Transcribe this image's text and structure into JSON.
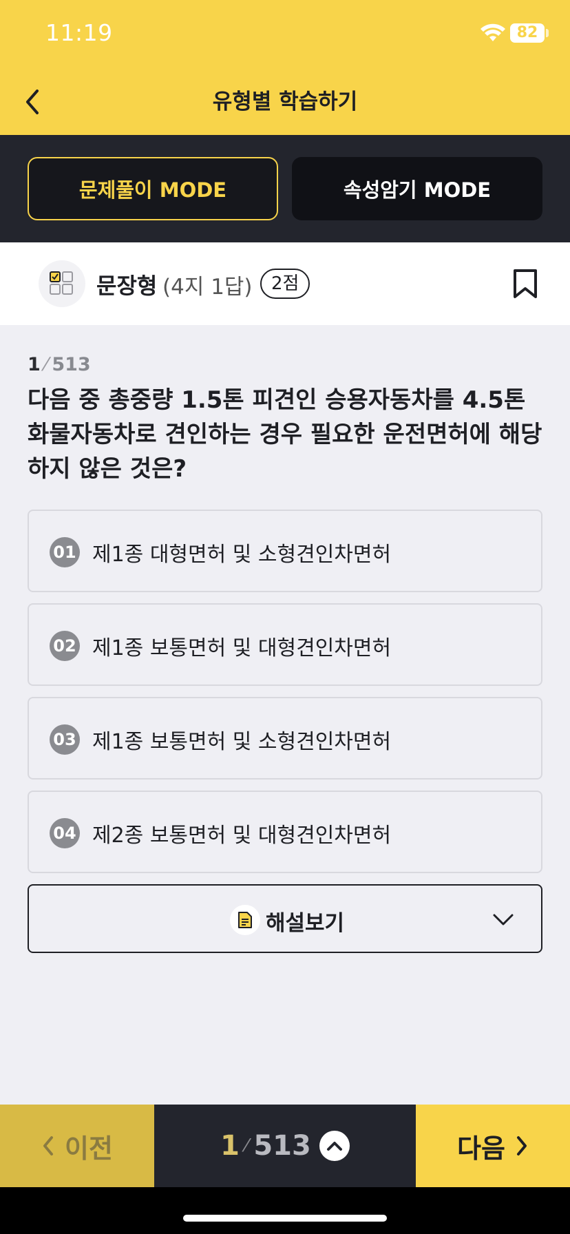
{
  "status_bar": {
    "time": "11:19",
    "battery": "82"
  },
  "nav": {
    "title": "유형별 학습하기"
  },
  "modes": {
    "active_label": "문제풀이 MODE",
    "inactive_label": "속성암기 MODE"
  },
  "question_type": {
    "label": "문장형",
    "desc": "(4지 1답)",
    "score": "2점"
  },
  "counter": {
    "current": "1",
    "separator": "⁄",
    "total": "513"
  },
  "question": {
    "text": "다음 중 총중량 1.5톤 피견인 승용자동차를 4.5톤 화물자동차로 견인하는 경우 필요한 운전면허에 해당하지 않은 것은?"
  },
  "options": [
    {
      "num": "01",
      "text": "제1종 대형면허 및 소형견인차면허"
    },
    {
      "num": "02",
      "text": "제1종 보통면허 및 대형견인차면허"
    },
    {
      "num": "03",
      "text": "제1종 보통면허 및 소형견인차면허"
    },
    {
      "num": "04",
      "text": "제2종 보통면허 및 대형견인차면허"
    }
  ],
  "explain": {
    "label": "해설보기"
  },
  "bottom": {
    "prev_label": "이전",
    "next_label": "다음",
    "pager_current": "1",
    "pager_separator": "⁄",
    "pager_total": "513"
  },
  "colors": {
    "accent": "#f8d44a",
    "dark": "#23252d"
  }
}
